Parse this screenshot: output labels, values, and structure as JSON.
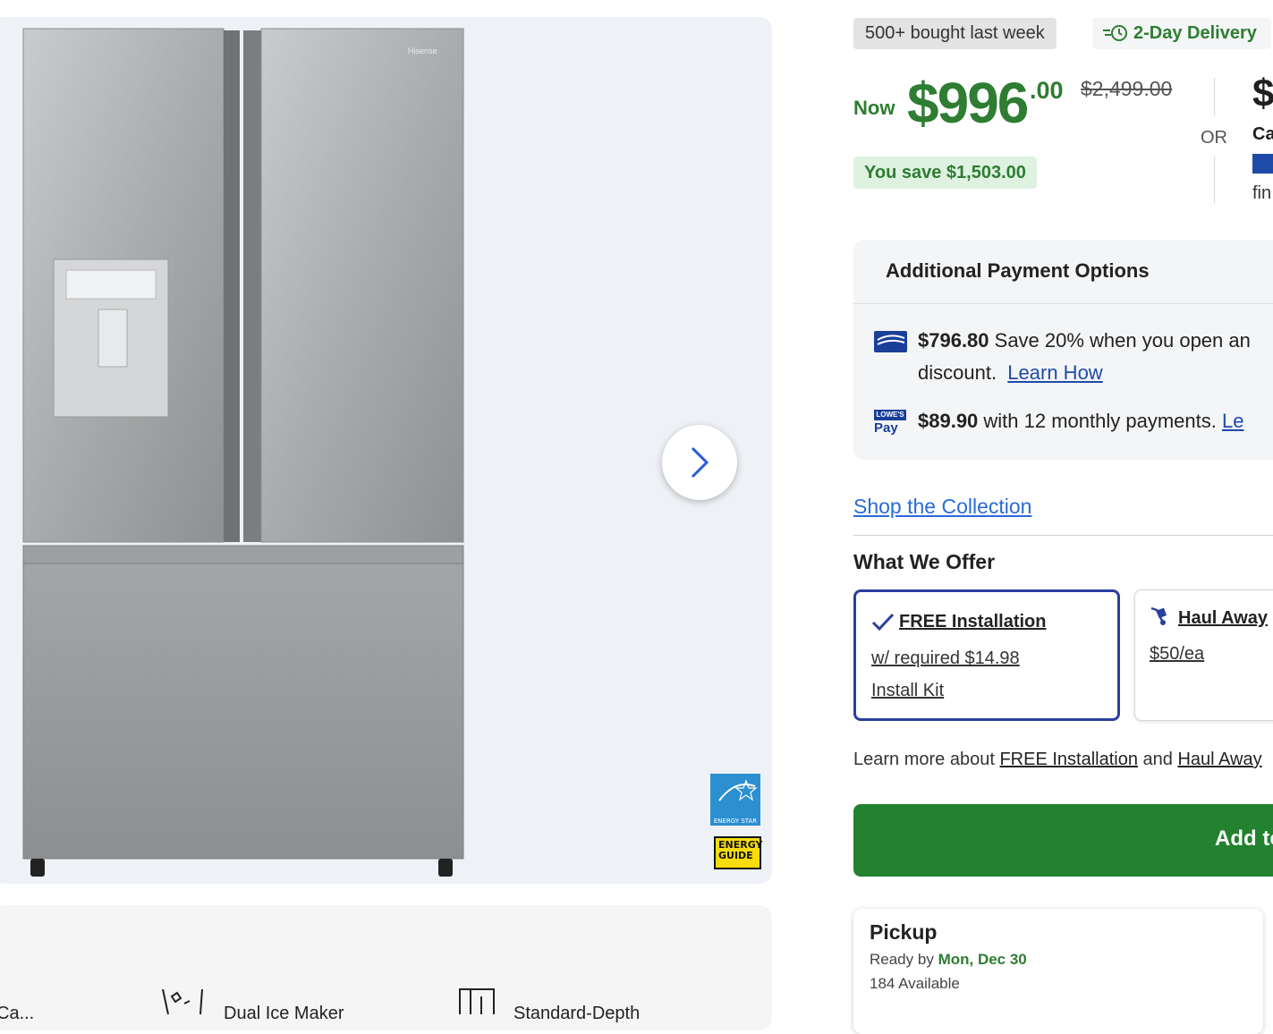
{
  "gallery": {
    "product_image_alt": "Hisense stainless steel French door refrigerator",
    "brand_mark": "Hisense",
    "energy_star_label": "ENERGY STAR",
    "energy_guide_label": "ENERGY GUIDE",
    "next_icon": "chevron-right-icon"
  },
  "features": {
    "items": [
      "Ca...",
      "Dual Ice Maker",
      "Standard-Depth"
    ]
  },
  "badges": {
    "bought": "500+ bought last week",
    "delivery": "2-Day Delivery"
  },
  "price": {
    "now_label": "Now",
    "dollars": "$996",
    "cents": ".00",
    "was": "$2,499.00",
    "you_save": "You save $1,503.00",
    "or_label": "OR",
    "alt_dollar": "$",
    "alt_card_label": "Ca",
    "alt_financing": "fin"
  },
  "payment_options": {
    "title": "Additional Payment Options",
    "card_amount": "$796.80",
    "card_text": " Save 20% when you open an",
    "card_text2": "discount.",
    "card_link": "Learn How",
    "lowes_pay_amount": "$89.90",
    "lowes_pay_text": " with 12 monthly payments.",
    "lowes_pay_link": "Le",
    "lowes_pay_logo_top": "LOWE'S",
    "lowes_pay_logo_bottom": "Pay"
  },
  "shop_collection": "Shop the Collection",
  "offers": {
    "title": "What We Offer",
    "install_title": "FREE Installation",
    "install_line1": "w/ required $14.98",
    "install_line2": "Install Kit",
    "haul_title": "Haul Away",
    "haul_price": "$50/ea",
    "learn_prefix": "Learn more about",
    "learn_link1": "FREE Installation",
    "learn_and": "and",
    "learn_link2": "Haul Away"
  },
  "add_button": "Add to Cart",
  "pickup": {
    "title": "Pickup",
    "ready_prefix": "Ready by",
    "ready_date": "Mon, Dec 30",
    "available": "184 Available"
  },
  "colors": {
    "green": "#2e7d32",
    "cta_green": "#22822f",
    "link_blue": "#2a6bd6",
    "navy": "#2b3f9e"
  }
}
